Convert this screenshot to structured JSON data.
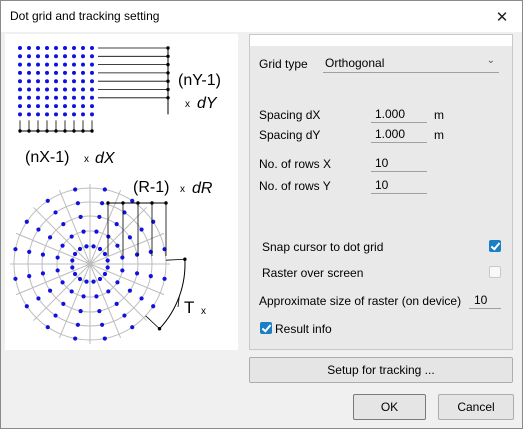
{
  "window": {
    "title": "Dot grid and tracking setting",
    "close_icon": "close-icon"
  },
  "diagram": {
    "ny_label": "(nY-1)",
    "dy_label_x": "x",
    "dy_label_var": "dY",
    "nx_label": "(nX-1)",
    "dx_label_x": "x",
    "dx_label_var": "dX",
    "r_label": "(R-1)",
    "dr_label_x": "x",
    "dr_label_var": "dR",
    "t_label": "T",
    "t_label_x": "x",
    "dot_color": "#1010e0"
  },
  "settings": {
    "grid_type": {
      "label": "Grid type",
      "value": "Orthogonal"
    },
    "spacing_dx": {
      "label": "Spacing dX",
      "value": "1.000",
      "unit": "m"
    },
    "spacing_dy": {
      "label": "Spacing dY",
      "value": "1.000",
      "unit": "m"
    },
    "rows_x": {
      "label": "No. of rows X",
      "value": "10"
    },
    "rows_y": {
      "label": "No. of rows Y",
      "value": "10"
    },
    "snap": {
      "label": "Snap cursor to dot grid",
      "checked": true
    },
    "raster": {
      "label": "Raster over screen",
      "checked": false
    },
    "approx": {
      "label": "Approximate size of raster (on device)",
      "value": "10"
    },
    "result_info": {
      "label": "Result info",
      "checked": true
    }
  },
  "buttons": {
    "setup": "Setup for tracking ...",
    "ok": "OK",
    "cancel": "Cancel"
  },
  "colors": {
    "accent": "#1a7fc4"
  }
}
